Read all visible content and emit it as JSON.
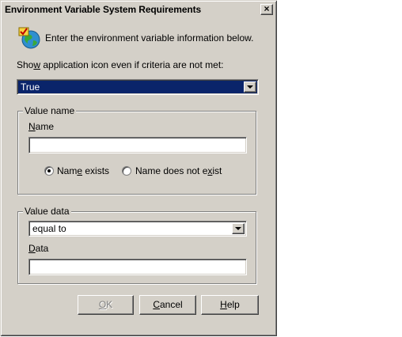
{
  "window": {
    "title": "Environment Variable System Requirements",
    "close_label": "×"
  },
  "intro": {
    "text": "Enter the environment variable information below."
  },
  "show_icon": {
    "label_pre": "Sho",
    "label_accel": "w",
    "label_post": " application icon even if criteria are not met:",
    "selected": "True"
  },
  "value_name": {
    "group_title": "Value name",
    "name_label_accel": "N",
    "name_label_rest": "ame",
    "name_value": "",
    "radio_exists_pre": "Nam",
    "radio_exists_accel": "e",
    "radio_exists_post": " exists",
    "radio_not_pre": "Name does not e",
    "radio_not_accel": "x",
    "radio_not_post": "ist",
    "selected_radio": "exists"
  },
  "value_data": {
    "group_title": "Value data",
    "operator_selected": "equal to",
    "data_label_accel": "D",
    "data_label_rest": "ata",
    "data_value": ""
  },
  "buttons": {
    "ok_accel": "O",
    "ok_rest": "K",
    "cancel_accel": "C",
    "cancel_rest": "ancel",
    "help_accel": "H",
    "help_rest": "elp"
  }
}
